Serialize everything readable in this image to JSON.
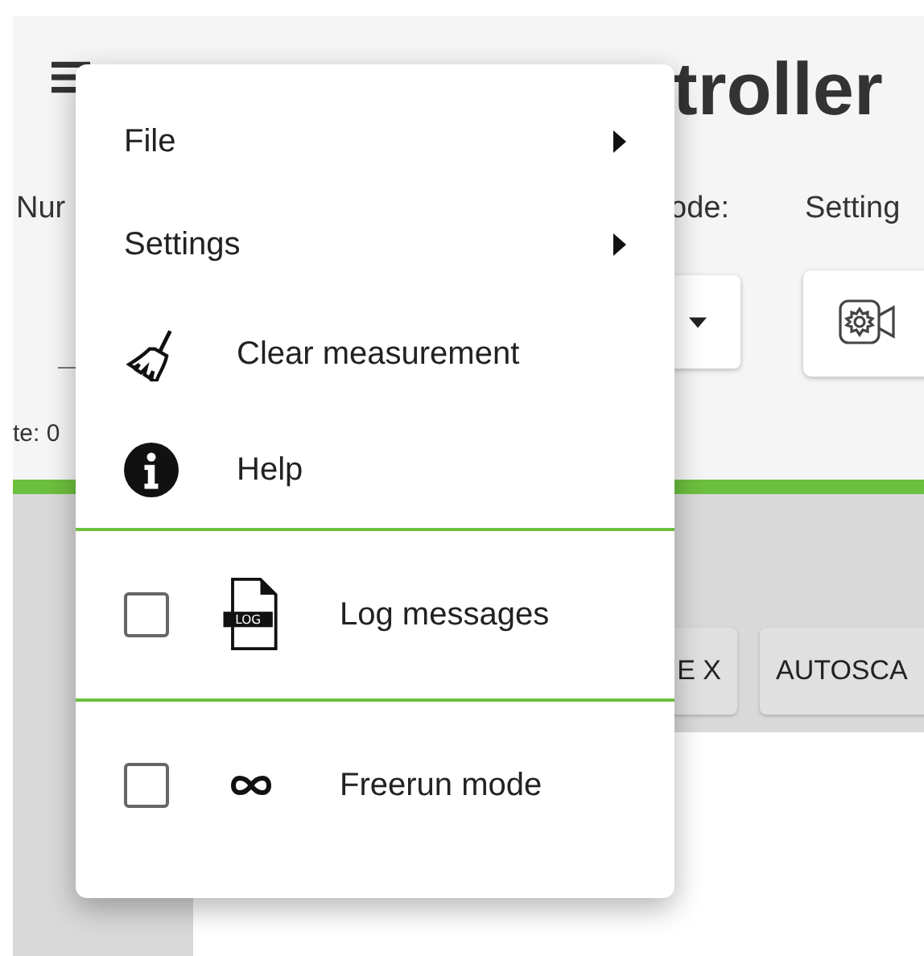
{
  "background": {
    "title": "troller",
    "labels": [
      "Nur",
      "ode:",
      "Setting"
    ],
    "status": "te: 0",
    "buttons": [
      "E X",
      "AUTOSCA"
    ]
  },
  "menu": {
    "items": [
      {
        "kind": "submenu",
        "label": "File",
        "divider_before": false
      },
      {
        "kind": "submenu",
        "label": "Settings",
        "divider_before": false
      },
      {
        "kind": "action",
        "label": "Clear measurement",
        "divider_before": false
      },
      {
        "kind": "action",
        "label": "Help",
        "divider_before": false
      },
      {
        "kind": "toggle",
        "label": "Log messages",
        "checked": false,
        "icon_text": "LOG",
        "divider_before": true
      },
      {
        "kind": "toggle",
        "label": "Freerun mode",
        "checked": false,
        "divider_before": true
      }
    ]
  }
}
